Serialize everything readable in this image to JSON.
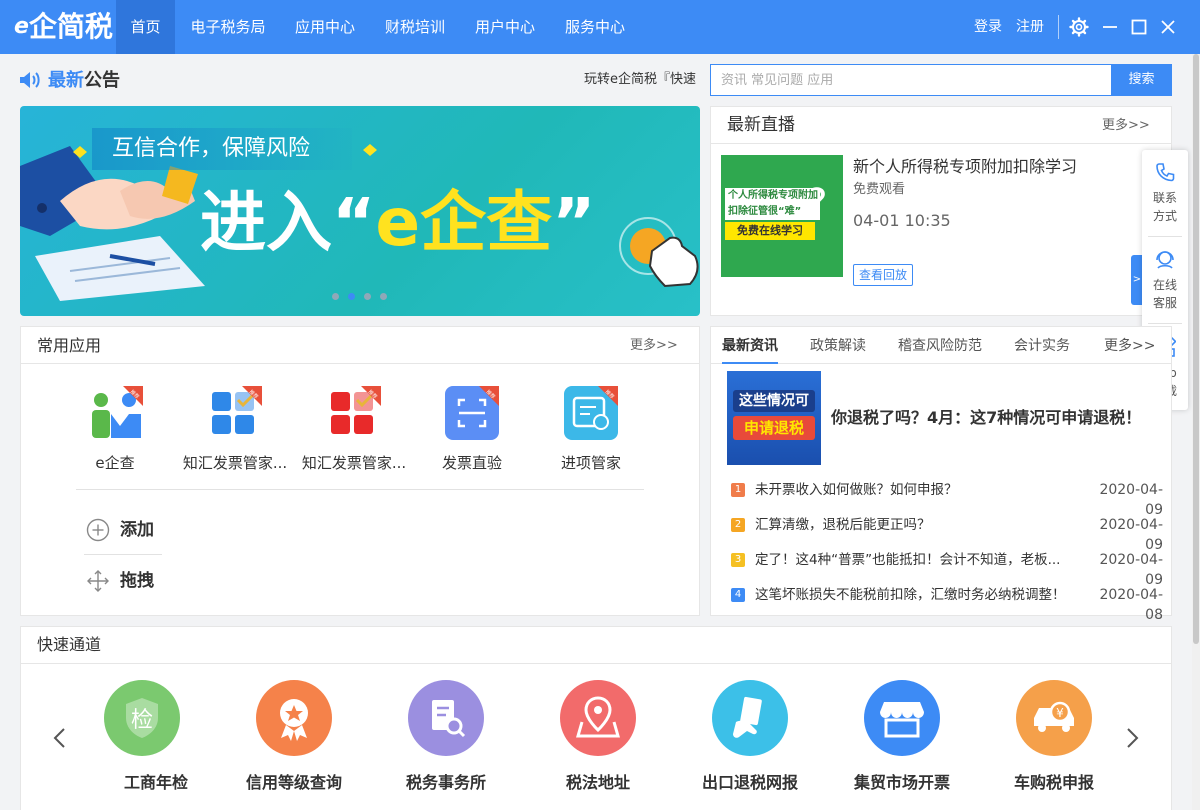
{
  "app": {
    "logo": "e企简税",
    "logo_e": "e",
    "logo_rest": "企简税"
  },
  "nav": {
    "items": [
      {
        "label": "首页",
        "active": true
      },
      {
        "label": "电子税务局"
      },
      {
        "label": "应用中心"
      },
      {
        "label": "财税培训"
      },
      {
        "label": "用户中心"
      },
      {
        "label": "服务中心"
      }
    ],
    "login": "登录",
    "register": "注册"
  },
  "announcement": {
    "title_blue": "最新",
    "title_rest": "公告",
    "ticker": "玩转e企简税『快速"
  },
  "search": {
    "placeholder": "资讯 常见问题 应用",
    "button": "搜索"
  },
  "banner": {
    "subtitle": "互信合作，保障风险",
    "main_prefix": "进入“",
    "main_highlight": "e企查",
    "main_suffix": "”",
    "slides": 4,
    "active_slide": 2
  },
  "live": {
    "title": "最新直播",
    "more": "更多>>",
    "thumb_text_1": "个人所得税专项附加",
    "thumb_text_2": "扣除征管很“难”",
    "thumb_free": "免费在线学习",
    "name": "新个人所得税专项附加扣除学习",
    "free": "免费观看",
    "time": "04-01 10:35",
    "replay": "查看回放"
  },
  "side": {
    "contact": "联系方式",
    "contact_1": "联系",
    "contact_2": "方式",
    "service_1": "在线",
    "service_2": "客服",
    "app_1": "App",
    "app_2": "下载",
    "tab": ">"
  },
  "apps": {
    "title": "常用应用",
    "more": "更多>>",
    "badge": "推荐",
    "items": [
      {
        "label": "e企查"
      },
      {
        "label": "知汇发票管家..."
      },
      {
        "label": "知汇发票管家..."
      },
      {
        "label": "发票直验"
      },
      {
        "label": "进项管家"
      }
    ],
    "add": "添加",
    "drag": "拖拽"
  },
  "news": {
    "tabs": [
      "最新资讯",
      "政策解读",
      "稽查风险防范",
      "会计实务",
      "更多>>"
    ],
    "thumb_1": "这些情况可",
    "thumb_2": "申请退税",
    "headline": "你退税了吗？4月：这7种情况可申请退税！",
    "items": [
      {
        "num": "1",
        "text": "未开票收入如何做账？如何申报？",
        "date": "2020-04-09",
        "color": "#f07c4a"
      },
      {
        "num": "2",
        "text": "汇算清缴，退税后能更正吗？",
        "date": "2020-04-09",
        "color": "#f5a623"
      },
      {
        "num": "3",
        "text": "定了！这4种“普票”也能抵扣！会计不知道，老板...",
        "date": "2020-04-09",
        "color": "#f5c023"
      },
      {
        "num": "4",
        "text": "这笔坏账损失不能税前扣除，汇缴时务必纳税调整！",
        "date": "2020-04-08",
        "color": "#3d8bf5"
      }
    ]
  },
  "quick": {
    "title": "快速通道",
    "items": [
      {
        "label": "工商年检",
        "color": "#7bc96f",
        "glyph": "检"
      },
      {
        "label": "信用等级查询",
        "color": "#f5824a",
        "glyph": "★"
      },
      {
        "label": "税务事务所",
        "color": "#9b8fe0",
        "glyph": "☰"
      },
      {
        "label": "税法地址",
        "color": "#f26b6b",
        "glyph": "⚲"
      },
      {
        "label": "出口退税网报",
        "color": "#3cc0e8",
        "glyph": "✋"
      },
      {
        "label": "集贸市场开票",
        "color": "#3d8bf5",
        "glyph": "⌂"
      },
      {
        "label": "车购税申报",
        "color": "#f5a04a",
        "glyph": "¥"
      }
    ]
  }
}
